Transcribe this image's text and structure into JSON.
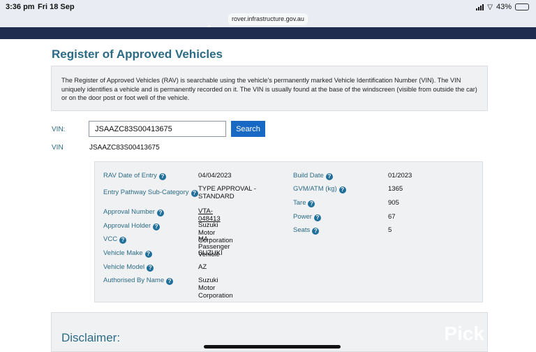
{
  "status_bar": {
    "time": "3:36 pm",
    "date": "Fri 18 Sep",
    "battery_percent": "43%",
    "battery_level": 0.43
  },
  "browser": {
    "url": "rover.infrastructure.gov.au"
  },
  "page": {
    "title": "Register of Approved Vehicles",
    "intro": "The Register of Approved Vehicles (RAV) is searchable using the vehicle's permanently marked Vehicle Identification Number (VIN). The VIN uniquely identifies a vehicle and is permanently recorded on it. The VIN is usually found at the base of the windscreen (visible from outside the car) or on the door post or foot well of the vehicle."
  },
  "search": {
    "label": "VIN:",
    "value": "JSAAZC83S00413675",
    "button": "Search"
  },
  "result": {
    "vin_label": "VIN",
    "vin_value": "JSAAZC83S00413675"
  },
  "details_left": [
    {
      "label": "RAV Date of Entry",
      "value": "04/04/2023"
    },
    {
      "label": "Entry Pathway Sub-Category",
      "value": "TYPE APPROVAL - STANDARD"
    },
    {
      "label": "Approval Number",
      "value": "VTA-048413"
    },
    {
      "label": "Approval Holder",
      "value": "Suzuki Motor Corporation"
    },
    {
      "label": "VCC",
      "value": "MA - Passenger Vehicle"
    },
    {
      "label": "Vehicle Make",
      "value": "SUZUKI"
    },
    {
      "label": "Vehicle Model",
      "value": "AZ"
    },
    {
      "label": "Authorised By Name",
      "value": "Suzuki Motor Corporation"
    }
  ],
  "details_right": [
    {
      "label": "Build Date",
      "value": "01/2023"
    },
    {
      "label": "GVM/ATM (kg)",
      "value": "1365"
    },
    {
      "label": "Tare",
      "value": "905"
    },
    {
      "label": "Power",
      "value": "67"
    },
    {
      "label": "Seats",
      "value": "5"
    }
  ],
  "help_icon_glyph": "?",
  "disclaimer": {
    "title": "Disclaimer:",
    "watermark": "Pick"
  }
}
